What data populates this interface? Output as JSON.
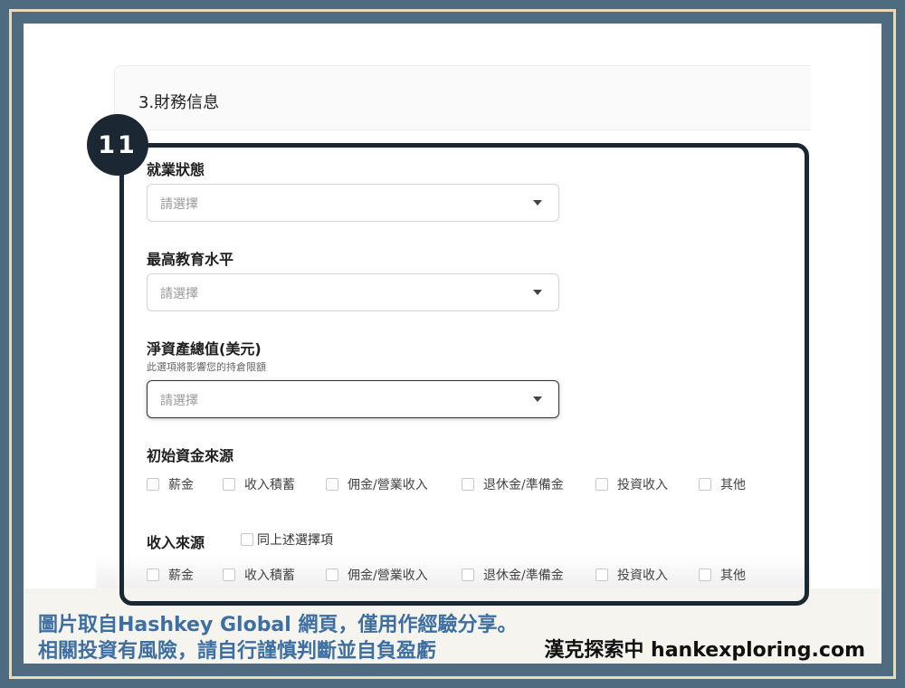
{
  "section": {
    "title": "3.財務信息"
  },
  "step_badge": "11",
  "fields": {
    "employment": {
      "label": "就業狀態",
      "placeholder": "請選擇"
    },
    "education": {
      "label": "最高教育水平",
      "placeholder": "請選擇"
    },
    "net_worth": {
      "label": "淨資產總值(美元)",
      "hint": "此選項將影響您的持倉限額",
      "placeholder": "請選擇"
    },
    "initial_funds": {
      "label": "初始資金來源",
      "options": [
        "薪金",
        "收入積蓄",
        "佣金/營業收入",
        "退休金/準備金",
        "投資收入",
        "其他"
      ]
    },
    "income_source": {
      "label": "收入來源",
      "same_as_above": "同上述選擇項",
      "options": [
        "薪金",
        "收入積蓄",
        "佣金/營業收入",
        "退休金/準備金",
        "投資收入",
        "其他"
      ]
    }
  },
  "caption": {
    "line1": "圖片取自Hashkey Global 網頁，僅用作經驗分享。",
    "line2": "相關投資有風險，請自行謹慎判斷並自負盈虧",
    "brand": "漢克探索中 hankexploring.com"
  },
  "colors": {
    "frame": "#4f6b80",
    "frame_line": "#e8d9b8",
    "highlight": "#1b2833",
    "caption_text": "#3e6fa3"
  }
}
